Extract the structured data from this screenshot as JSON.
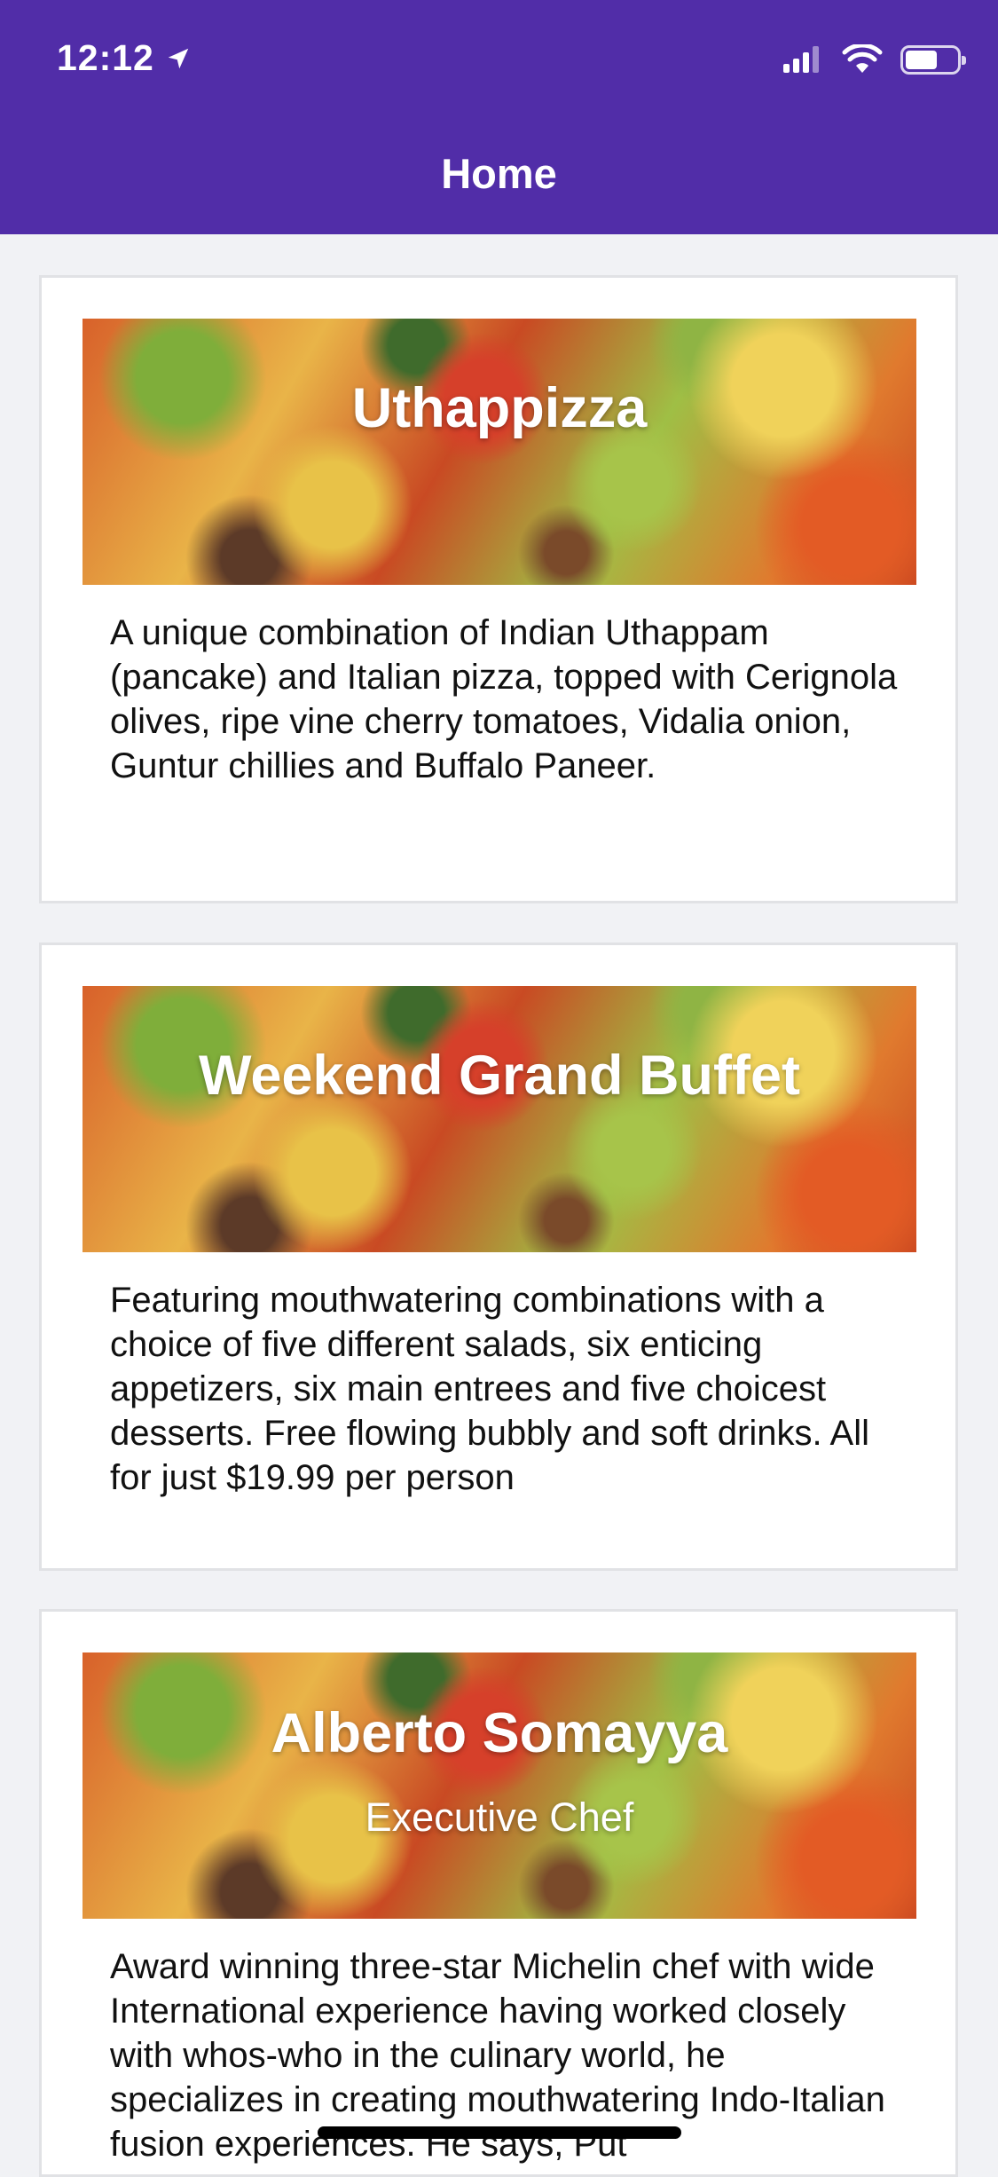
{
  "status_bar": {
    "time": "12:12"
  },
  "nav": {
    "title": "Home"
  },
  "cards": [
    {
      "title": "Uthappizza",
      "description": "A unique combination of Indian Uthappam (pancake) and Italian pizza, topped with Cerignola olives, ripe vine cherry tomatoes, Vidalia onion, Guntur chillies and Buffalo Paneer."
    },
    {
      "title": "Weekend Grand Buffet",
      "description": "Featuring mouthwatering combinations with a choice of five different salads, six enticing appetizers, six main entrees and five choicest desserts. Free flowing bubbly and soft drinks. All for just $19.99 per person"
    },
    {
      "title": "Alberto Somayya",
      "subtitle": "Executive Chef",
      "description": "Award winning three-star Michelin chef with wide International experience having worked closely with whos-who in the culinary world, he specializes in creating mouthwatering Indo-Italian fusion experiences. He says, Put"
    }
  ],
  "colors": {
    "header": "#512da8",
    "background": "#f1f2f5",
    "card": "#ffffff"
  },
  "icons": [
    "location-arrow-icon",
    "signal-icon",
    "wifi-icon",
    "battery-icon"
  ]
}
